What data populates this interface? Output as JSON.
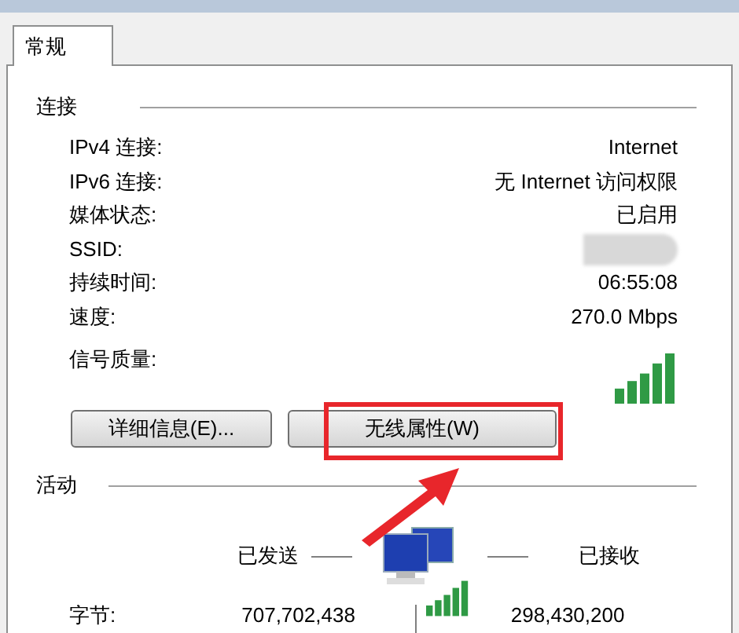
{
  "tabs": [
    {
      "label": "常规",
      "selected": true
    }
  ],
  "connection": {
    "heading": "连接",
    "rows": [
      {
        "kind": "text",
        "label": "IPv4 连接:",
        "value": "Internet"
      },
      {
        "kind": "text",
        "label": "IPv6 连接:",
        "value": "无 Internet 访问权限"
      },
      {
        "kind": "text",
        "label": "媒体状态:",
        "value": "已启用"
      },
      {
        "kind": "blurred",
        "label": "SSID:"
      },
      {
        "kind": "text",
        "label": "持续时间:",
        "value": "06:55:08"
      },
      {
        "kind": "text",
        "label": "速度:",
        "value": "270.0 Mbps"
      },
      {
        "kind": "signal",
        "label": "信号质量:"
      }
    ]
  },
  "buttons": [
    {
      "label": "详细信息(E)...",
      "highlighted": false
    },
    {
      "label": "无线属性(W)",
      "highlighted": true
    }
  ],
  "activity": {
    "heading": "活动",
    "sent_label": "已发送",
    "received_label": "已接收",
    "bytes_label": "字节:",
    "bytes_sent": "707,702,438",
    "bytes_received": "298,430,200"
  }
}
